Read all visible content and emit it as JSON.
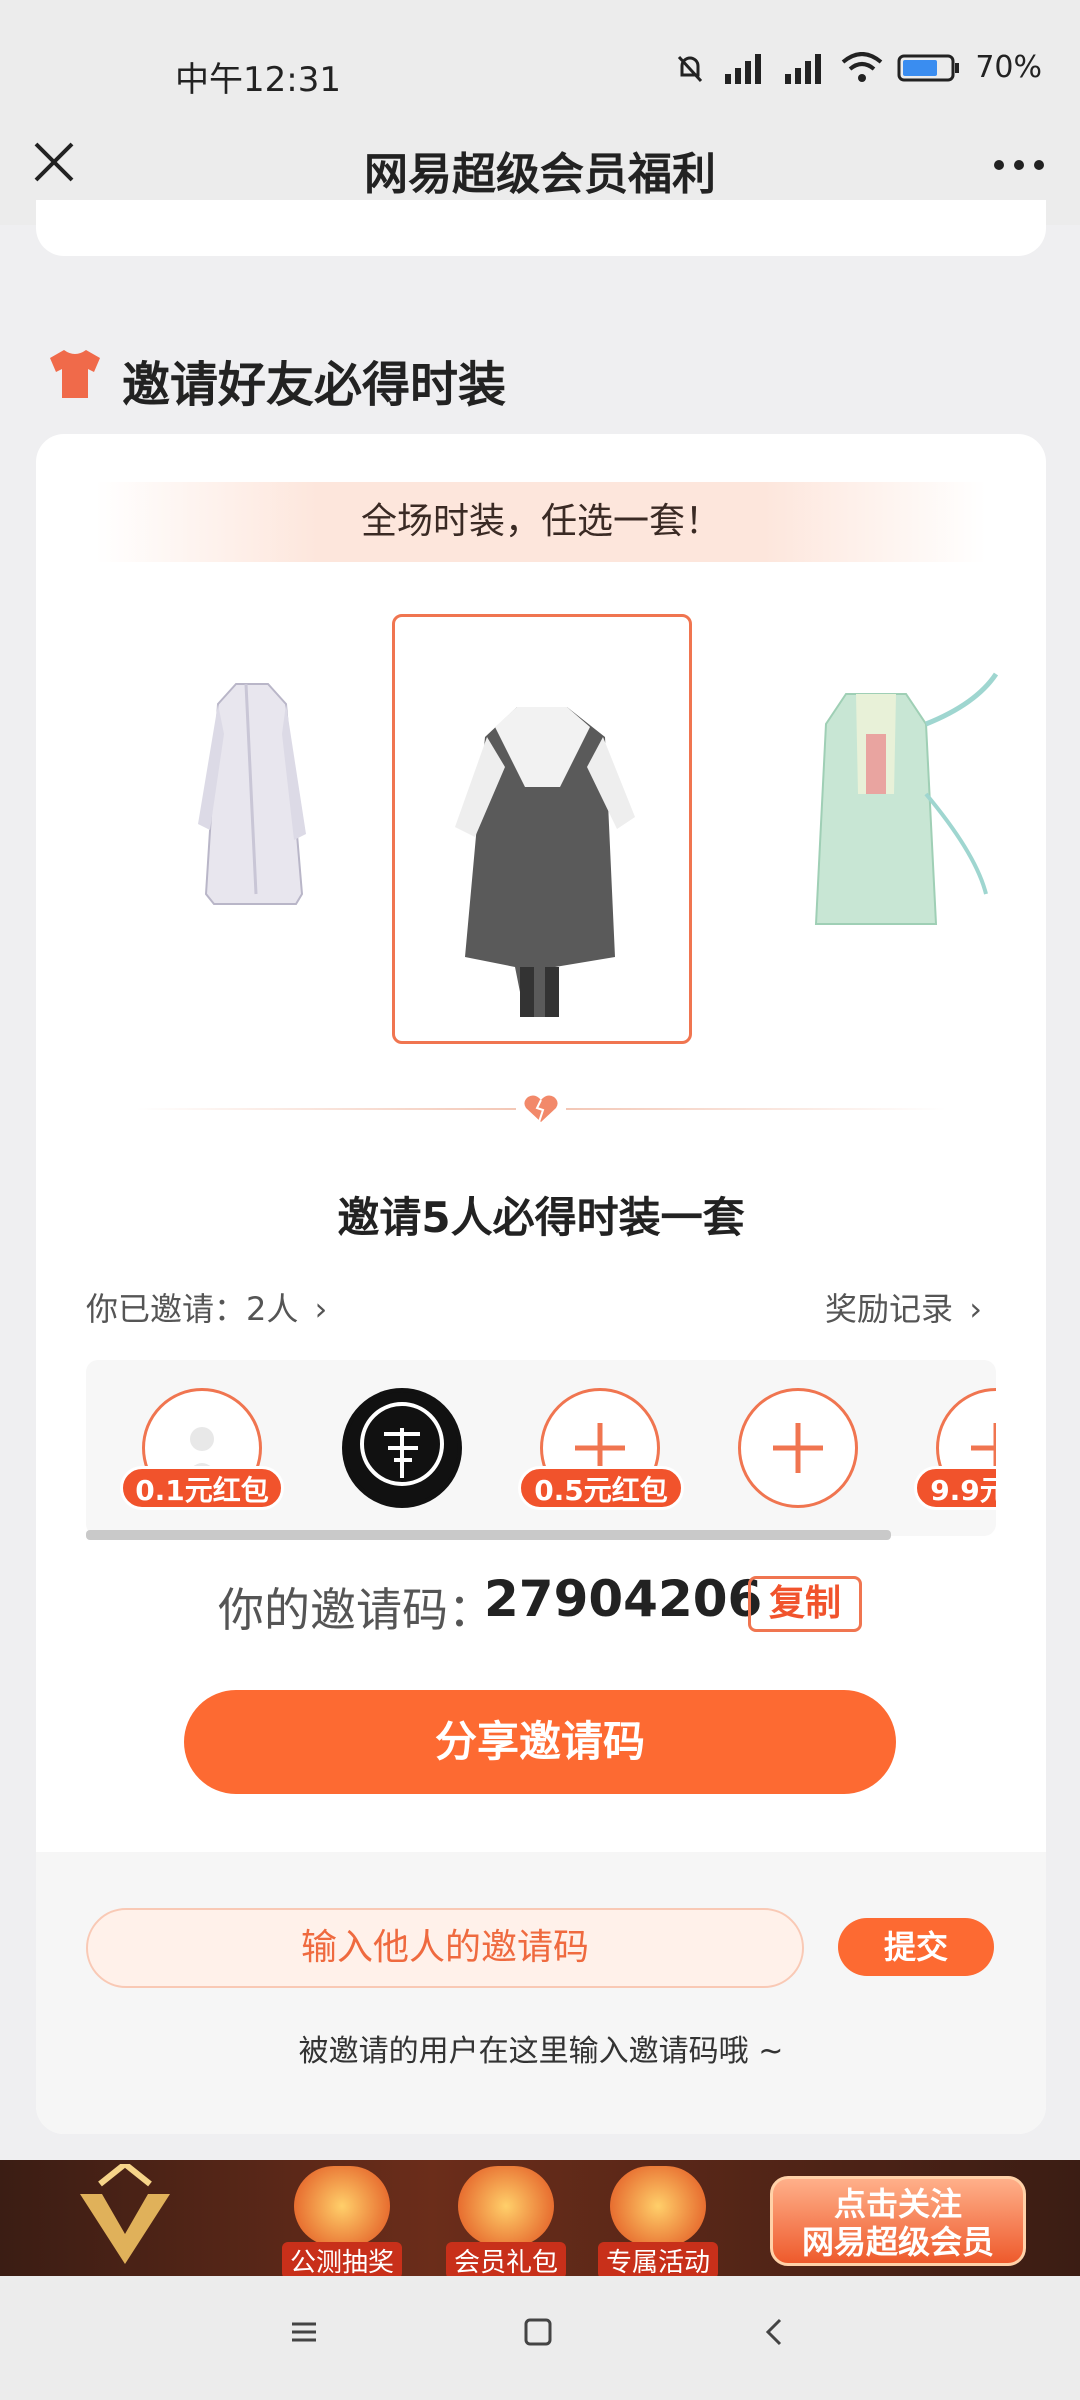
{
  "status_bar": {
    "time": "中午12:31",
    "battery": "70%"
  },
  "header": {
    "title": "网易超级会员福利"
  },
  "section": {
    "title": "邀请好友必得时装"
  },
  "card": {
    "banner": "全场时装，任选一套！",
    "invite_title": "邀请5人必得时装一套",
    "invited_label": "你已邀请：2人",
    "record_label": "奖励记录",
    "slots": [
      {
        "tag": "0.1元红包",
        "state": "avatar-placeholder"
      },
      {
        "tag": "",
        "state": "avatar-user"
      },
      {
        "tag": "0.5元红包",
        "state": "add"
      },
      {
        "tag": "",
        "state": "add"
      },
      {
        "tag": "9.9元",
        "state": "add"
      }
    ],
    "code_label": "你的邀请码：",
    "code_value": "27904206",
    "copy_label": "复制",
    "share_label": "分享邀请码",
    "input_placeholder": "输入他人的邀请码",
    "submit_label": "提交",
    "hint": "被邀请的用户在这里输入邀请码哦 ~"
  },
  "promo": {
    "items": [
      "公测抽奖",
      "会员礼包",
      "专属活动"
    ],
    "button_line1": "点击关注",
    "button_line2": "网易超级会员"
  },
  "colors": {
    "accent": "#fd6a32",
    "tag": "#f1532c",
    "bg": "#efeff1"
  }
}
